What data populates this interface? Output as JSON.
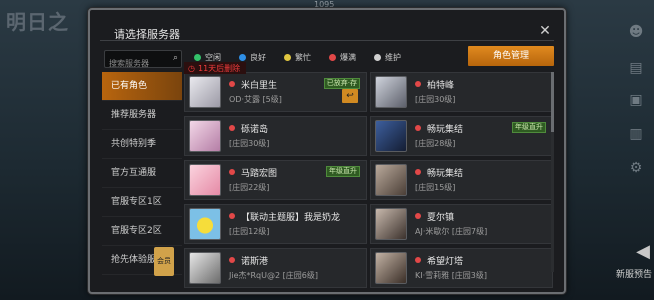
{
  "background": {
    "title": "明日之",
    "top_mark": "1095"
  },
  "right_tools": {
    "preview_label": "新服预告"
  },
  "panel": {
    "title": "请选择服务器",
    "search": {
      "placeholder": "搜索服务器"
    },
    "legend": [
      {
        "label": "空闲",
        "color": "#33c26a"
      },
      {
        "label": "良好",
        "color": "#2e8fe6"
      },
      {
        "label": "繁忙",
        "color": "#e0c640"
      },
      {
        "label": "爆满",
        "color": "#e24848"
      },
      {
        "label": "维护",
        "color": "#d0d0d0"
      }
    ],
    "role_button": "角色管理",
    "countdown": "11天后删除",
    "sidebar": [
      {
        "label": "已有角色",
        "active": true
      },
      {
        "label": "推荐服务器"
      },
      {
        "label": "共创特别季"
      },
      {
        "label": "官方互通服"
      },
      {
        "label": "官服专区1区"
      },
      {
        "label": "官服专区2区"
      },
      {
        "label": "抢先体验服",
        "badge": "会员"
      }
    ],
    "servers": [
      {
        "name": "米白里生",
        "role": "OD·艾露 [5级]",
        "tag": "已放弃·存",
        "undo": "↩",
        "avatar": "avatar-white-hair"
      },
      {
        "name": "柏特峰",
        "role": "[庄园30级]",
        "avatar": "avatar-anime-silver"
      },
      {
        "name": "砾诺岛",
        "role": "[庄园30级]",
        "avatar": "avatar-pink-flower"
      },
      {
        "name": "畅玩集结",
        "role": "[庄园28级]",
        "tag": "年级直升",
        "avatar": "avatar-dark-blue"
      },
      {
        "name": "马踏宏图",
        "role": "[庄园22级]",
        "tag": "年级直升",
        "avatar": "avatar-pink-cake"
      },
      {
        "name": "畅玩集结",
        "role": "[庄园15级]",
        "avatar": "avatar-woman-1"
      },
      {
        "name": "【联动主题服】我是奶龙",
        "role": "[庄园12级]",
        "avatar": "avatar-yellow-chick"
      },
      {
        "name": "夏尔镇",
        "role": "AJ·米歇尔 [庄园7级]",
        "avatar": "avatar-woman-2"
      },
      {
        "name": "诺斯港",
        "role": "Jie杰*RqU@2 [庄园6级]",
        "avatar": "avatar-ghost"
      },
      {
        "name": "希望灯塔",
        "role": "KI·雪莉雅 [庄园3级]",
        "avatar": "avatar-woman-3"
      }
    ]
  }
}
